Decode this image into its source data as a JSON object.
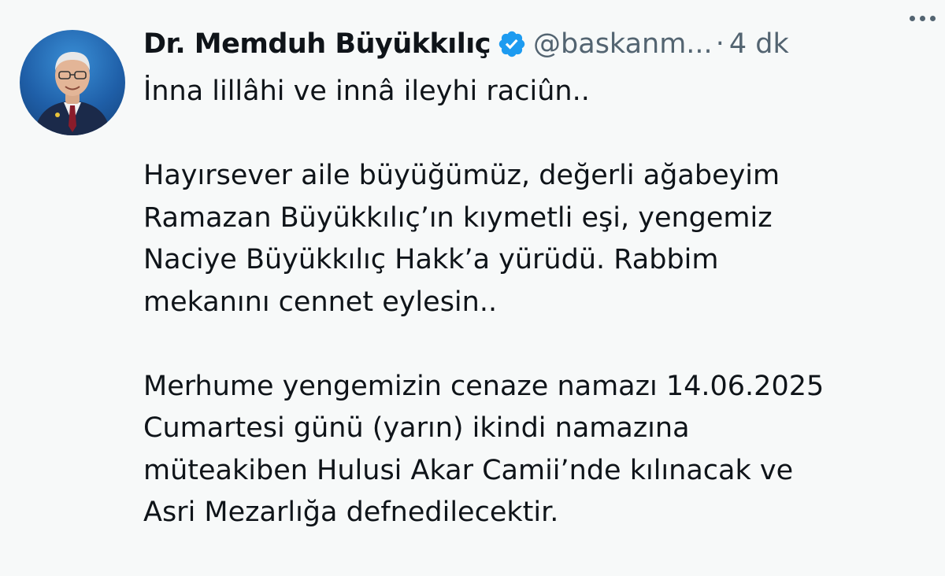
{
  "author": {
    "display_name": "Dr. Memduh Büyükkılıç",
    "handle": "@baskanm...",
    "separator": "·",
    "timestamp": "4 dk",
    "verified": true,
    "verified_color": "#1d9bf0"
  },
  "icons": {
    "verified": "verified-badge-icon",
    "more": "more-horizontal-icon"
  },
  "tweet": {
    "paragraph1": [
      "İnna lillâhi ve innâ ileyhi raciûn.."
    ],
    "paragraph2": [
      "Hayırsever aile büyüğümüz, değerli ağabeyim",
      "Ramazan Büyükkılıç’ın kıymetli eşi, yengemiz",
      "Naciye Büyükkılıç Hakk’a yürüdü. Rabbim",
      "mekanını cennet eylesin.."
    ],
    "paragraph3": [
      "Merhume yengemizin cenaze namazı 14.06.2025",
      "Cumartesi günü (yarın) ikindi namazına",
      "müteakiben Hulusi Akar Camii’nde kılınacak ve",
      "Asri Mezarlığa defnedilecektir."
    ]
  }
}
